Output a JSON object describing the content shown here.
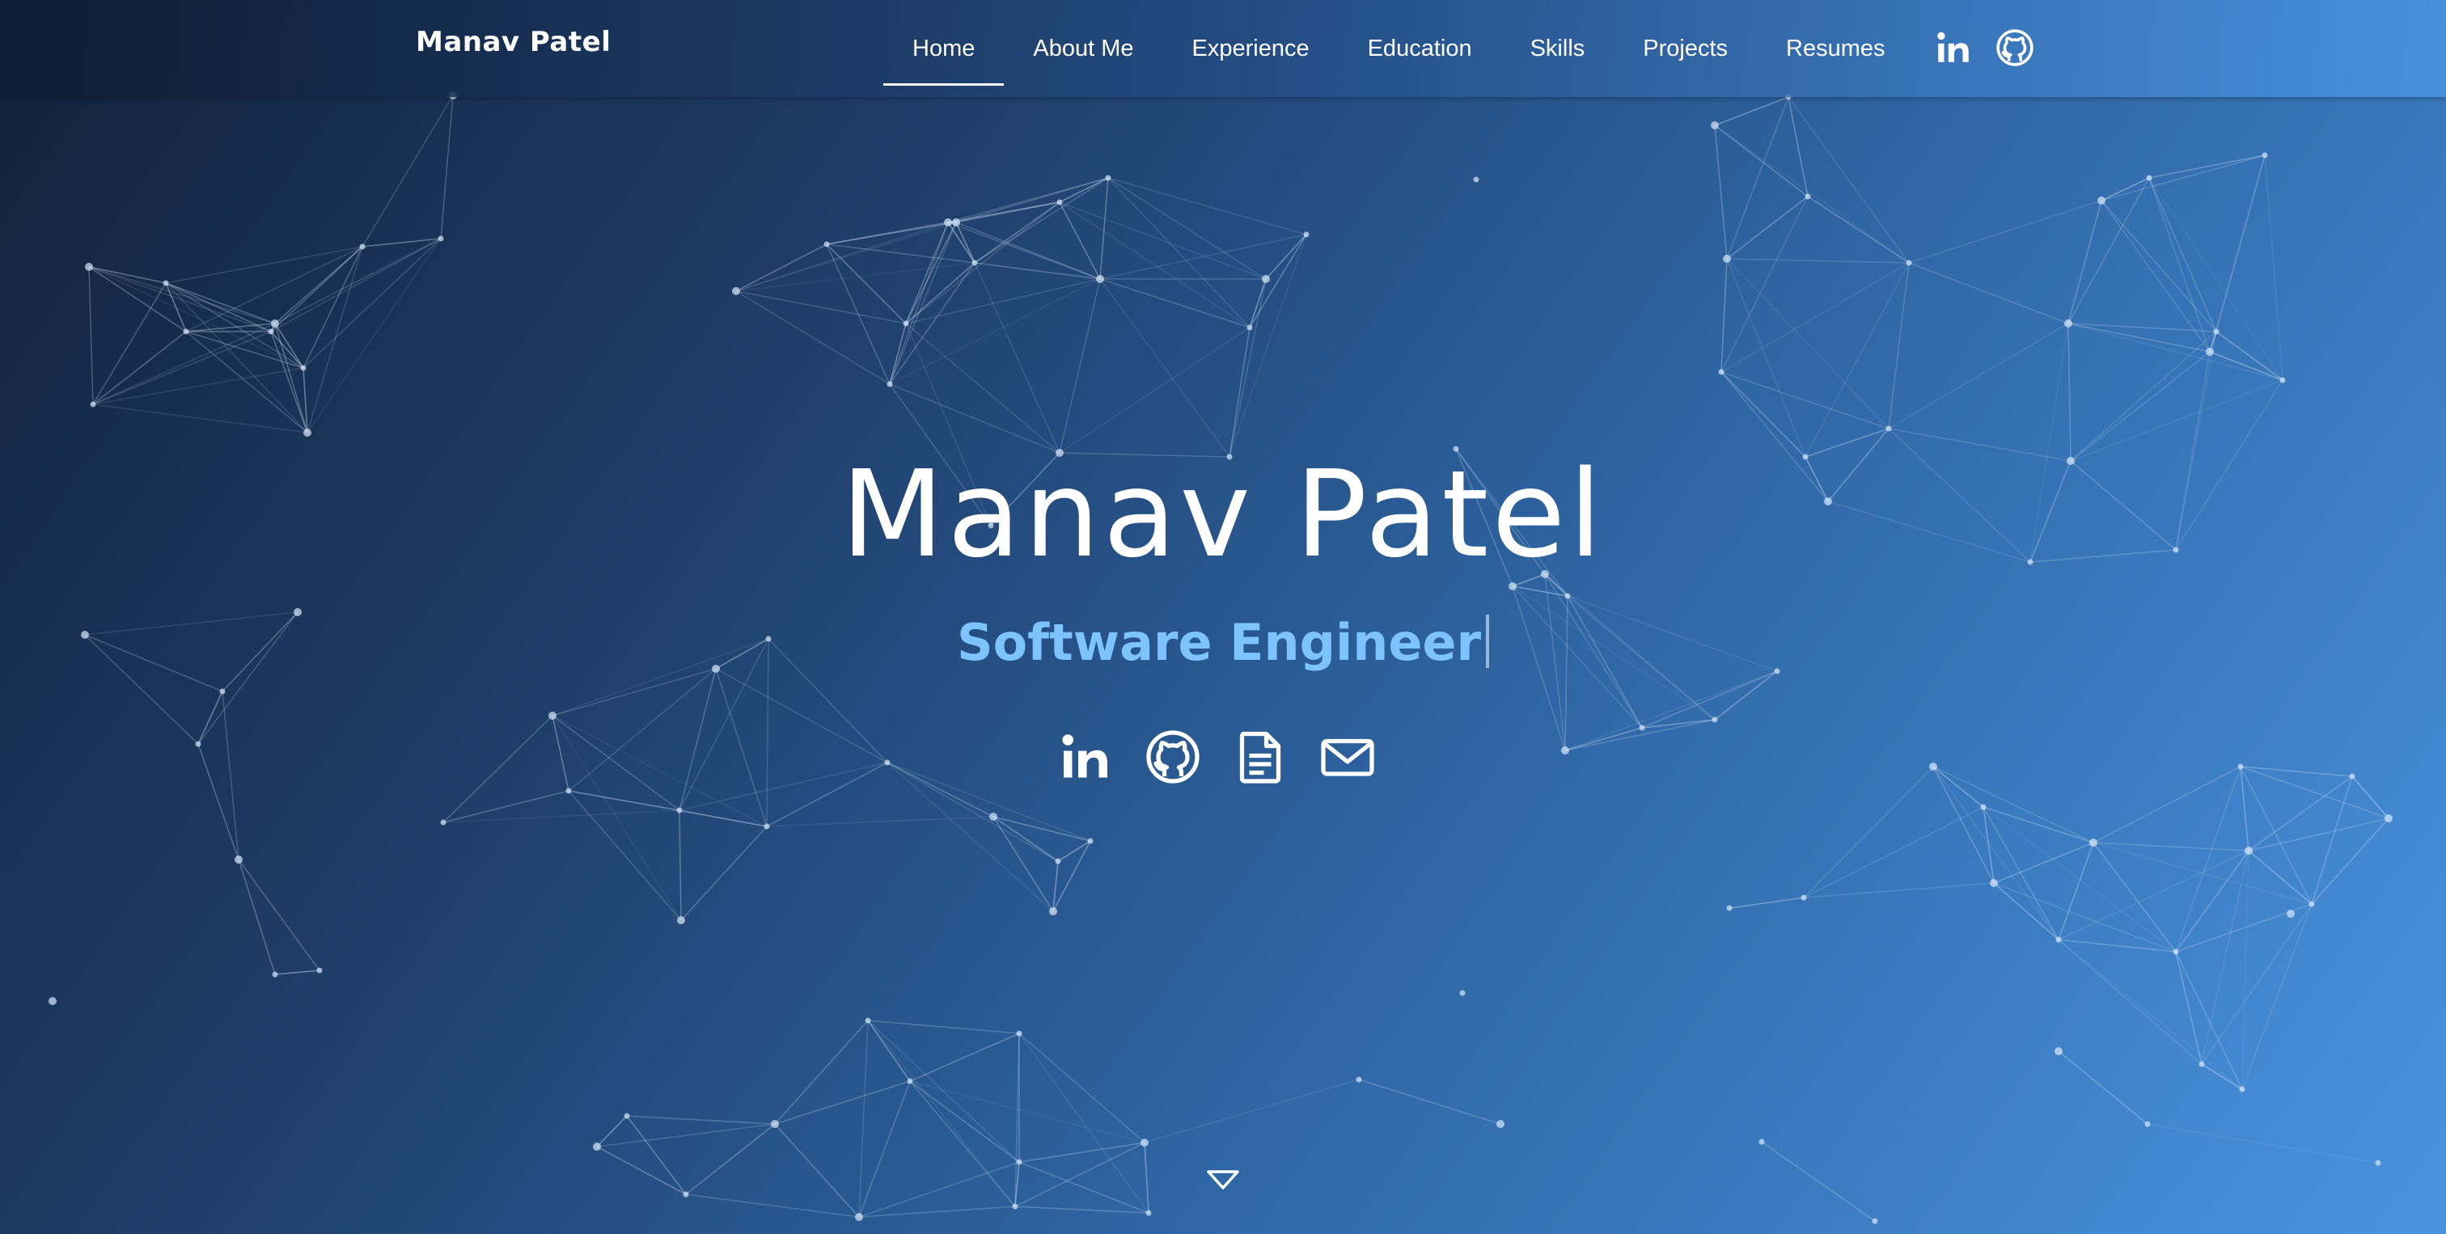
{
  "navbar": {
    "brand": "Manav Patel",
    "links": [
      {
        "label": "Home",
        "active": true
      },
      {
        "label": "About Me"
      },
      {
        "label": "Experience"
      },
      {
        "label": "Education"
      },
      {
        "label": "Skills"
      },
      {
        "label": "Projects"
      },
      {
        "label": "Resumes"
      }
    ],
    "icons": [
      "linkedin-icon",
      "github-icon"
    ]
  },
  "hero": {
    "name": "Manav Patel",
    "subtitle": "Software Engineer",
    "icons": [
      "linkedin-icon",
      "github-icon",
      "document-icon",
      "mail-icon"
    ],
    "scroll_icon": "chevron-down-icon"
  },
  "colors": {
    "background_start": "#12213a",
    "background_end": "#4a93df",
    "accent": "#7cc3ff",
    "text": "#ffffff"
  }
}
